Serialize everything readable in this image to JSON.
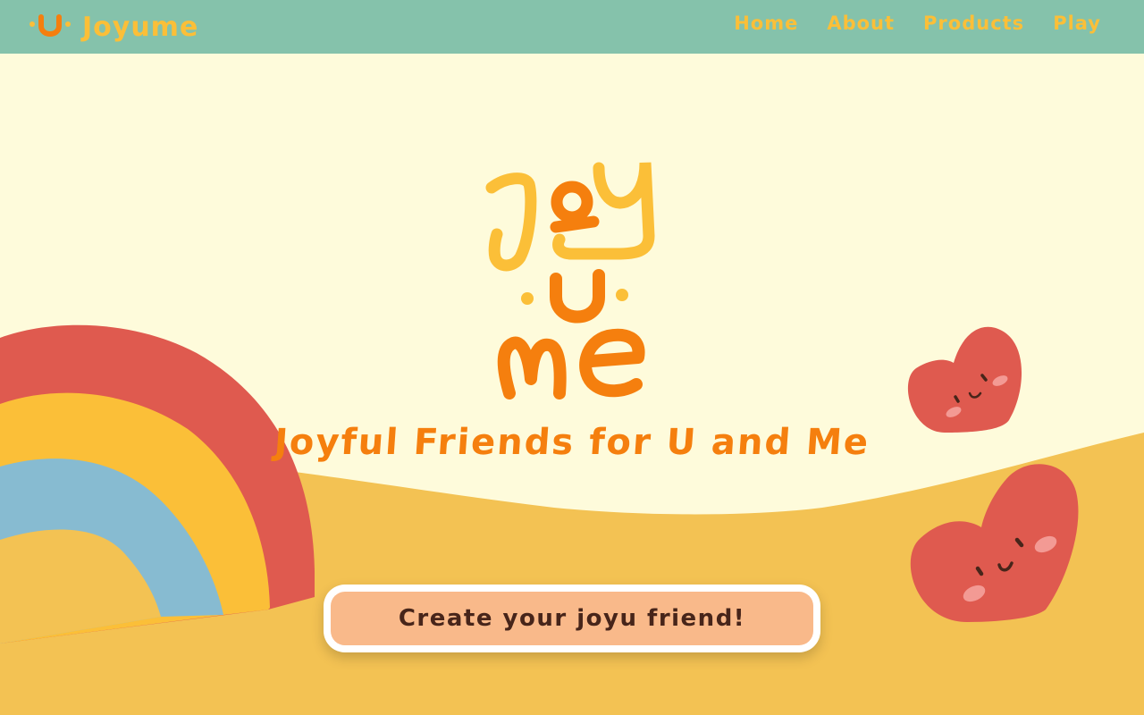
{
  "nav": {
    "brand_name": "Joyume",
    "brand_logo_icon": "smile-u-icon",
    "links": [
      {
        "label": "Home"
      },
      {
        "label": "About"
      },
      {
        "label": "Products"
      },
      {
        "label": "Play"
      }
    ]
  },
  "hero": {
    "logo_lines": [
      "Joy",
      "U",
      "Me"
    ],
    "tagline": "Joyful Friends for U and Me",
    "cta_label": "Create your joyu friend!"
  },
  "decor": {
    "rainbow_icon": "rainbow-icon",
    "heart_icons": [
      "heart-face-icon",
      "heart-face-icon"
    ]
  },
  "colors": {
    "nav_bg": "#85c2ab",
    "nav_text": "#fbbf38",
    "page_bg": "#fefbdb",
    "ground": "#f3c253",
    "accent_orange": "#f57f0e",
    "accent_yellow": "#fbbf38",
    "heart_red": "#df5a4f",
    "rainbow_blue": "#87bbd1",
    "cta_bg": "#f9b98a",
    "cta_text": "#47251a"
  }
}
